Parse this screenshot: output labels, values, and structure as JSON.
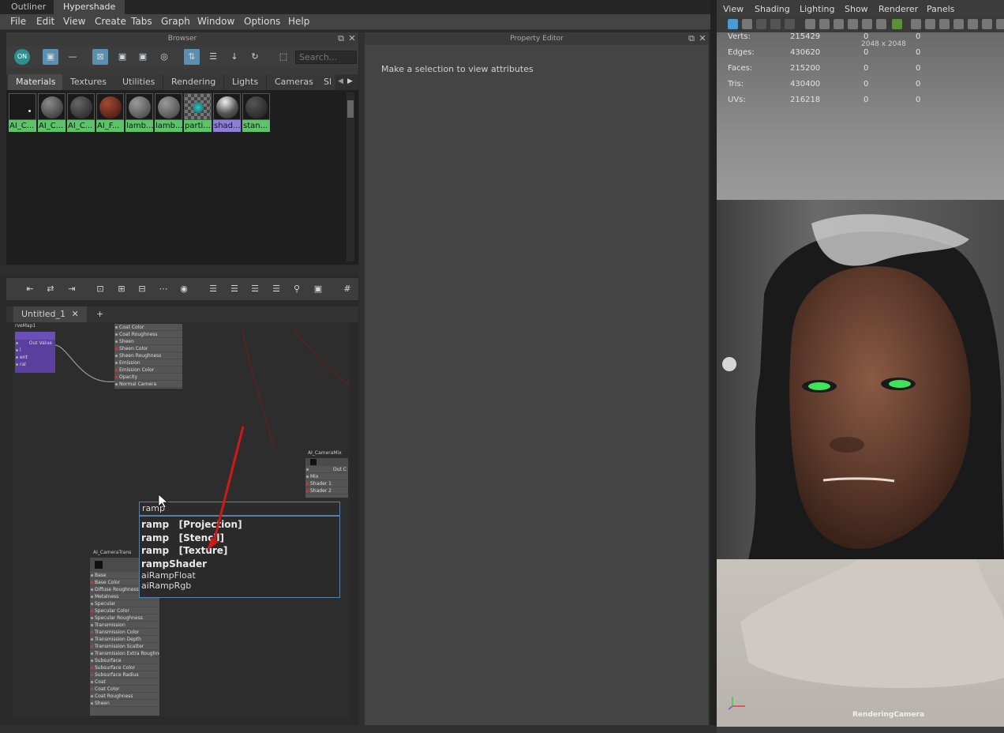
{
  "top_tabs": [
    "Outliner",
    "Hypershade"
  ],
  "menu": [
    "File",
    "Edit",
    "View",
    "Create",
    "Tabs",
    "Graph",
    "Window",
    "Options",
    "Help"
  ],
  "browser": {
    "title": "Browser",
    "search_placeholder": "Search...",
    "toolbar_toggle": "ON",
    "categories": [
      "Materials",
      "Textures",
      "Utilities",
      "Rendering",
      "Lights",
      "Cameras",
      "Sl"
    ],
    "swatches": [
      {
        "label": "AI_C..."
      },
      {
        "label": "AI_C..."
      },
      {
        "label": "AI_C..."
      },
      {
        "label": "AI_F..."
      },
      {
        "label": "lamb..."
      },
      {
        "label": "lamb..."
      },
      {
        "label": "parti..."
      },
      {
        "label": "shad..."
      },
      {
        "label": "stan..."
      }
    ]
  },
  "node_editor": {
    "tab_label": "Untitled_1",
    "tab_add": "+",
    "nodes": {
      "ramp_node": {
        "title": "rveMap1",
        "rows": [
          "Out Value",
          "l",
          "ent",
          "ral"
        ]
      },
      "shader_top": {
        "rows": [
          "Coat Color",
          "Coat Roughness",
          "Sheen",
          "Sheen Color",
          "Sheen Roughness",
          "Emission",
          "Emission Color",
          "Opacity",
          "Normal Camera"
        ]
      },
      "mix_node": {
        "title": "AI_CameraMix",
        "rows": [
          "Out C",
          "Mix",
          "Shader 1",
          "Shader 2"
        ]
      },
      "shader_bottom": {
        "title": "AI_CameraTrans",
        "rows": [
          "Base",
          "Base Color",
          "Diffuse Roughness",
          "Metalness",
          "Specular",
          "Specular Color",
          "Specular Roughness",
          "Transmission",
          "Transmission Color",
          "Transmission Depth",
          "Transmission Scatter",
          "Transmission Extra Roughness",
          "Subsurface",
          "Subsurface Color",
          "Subsurface Radius",
          "Coat",
          "Coat Color",
          "Coat Roughness",
          "Sheen"
        ]
      }
    },
    "popup": {
      "query": "ramp",
      "results": [
        {
          "text": "ramp   [Projection]",
          "style": "bold"
        },
        {
          "text": "ramp   [Stencil]",
          "style": "bold"
        },
        {
          "text": "ramp   [Texture]",
          "style": "bold"
        },
        {
          "text": "rampShader",
          "style": "bold"
        },
        {
          "text": "aiRampFloat",
          "style": "thin"
        },
        {
          "text": "aiRampRgb",
          "style": "thin"
        }
      ]
    }
  },
  "property_editor": {
    "title": "Property Editor",
    "message": "Make a selection to view attributes"
  },
  "viewport": {
    "menu": [
      "View",
      "Shading",
      "Lighting",
      "Show",
      "Renderer",
      "Panels"
    ],
    "hud": [
      {
        "label": "Verts:",
        "value": "215429",
        "a": "0",
        "b": "0"
      },
      {
        "label": "Edges:",
        "value": "430620",
        "a": "0",
        "b": "0"
      },
      {
        "label": "Faces:",
        "value": "215200",
        "a": "0",
        "b": "0"
      },
      {
        "label": "Tris:",
        "value": "430400",
        "a": "0",
        "b": "0"
      },
      {
        "label": "UVs:",
        "value": "216218",
        "a": "0",
        "b": "0"
      }
    ],
    "resolution": "2048 x 2048",
    "camera": "RenderingCamera"
  },
  "colors": {
    "swatch_label_green": "#5ec26b",
    "swatch_label_selected": "#8f7ed6",
    "accent_blue": "#5b8fb0",
    "annotation_red": "#d01818",
    "eye_glow": "#3ee35a"
  }
}
